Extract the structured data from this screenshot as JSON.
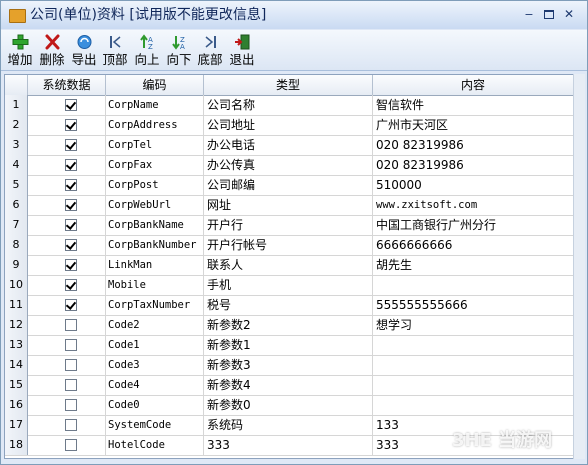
{
  "window": {
    "title": "公司(单位)资料 [试用版不能更改信息]"
  },
  "toolbar": {
    "buttons": [
      {
        "label": "增加",
        "icon": "add-icon"
      },
      {
        "label": "删除",
        "icon": "delete-icon"
      },
      {
        "label": "导出",
        "icon": "export-icon"
      },
      {
        "label": "顶部",
        "icon": "top-icon"
      },
      {
        "label": "向上",
        "icon": "up-icon"
      },
      {
        "label": "向下",
        "icon": "down-icon"
      },
      {
        "label": "底部",
        "icon": "bottom-icon"
      },
      {
        "label": "退出",
        "icon": "exit-icon"
      }
    ]
  },
  "table": {
    "columns": [
      "系统数据",
      "编码",
      "类型",
      "内容"
    ],
    "rows": [
      {
        "n": "1",
        "sys": true,
        "code": "CorpName",
        "type": "公司名称",
        "value": "智信软件"
      },
      {
        "n": "2",
        "sys": true,
        "code": "CorpAddress",
        "type": "公司地址",
        "value": "广州市天河区"
      },
      {
        "n": "3",
        "sys": true,
        "code": "CorpTel",
        "type": "办公电话",
        "value": "020 82319986"
      },
      {
        "n": "4",
        "sys": true,
        "code": "CorpFax",
        "type": "办公传真",
        "value": "020 82319986"
      },
      {
        "n": "5",
        "sys": true,
        "code": "CorpPost",
        "type": "公司邮编",
        "value": "510000"
      },
      {
        "n": "6",
        "sys": true,
        "code": "CorpWebUrl",
        "type": "网址",
        "value": "www.zxitsoft.com"
      },
      {
        "n": "7",
        "sys": true,
        "code": "CorpBankName",
        "type": "开户行",
        "value": "中国工商银行广州分行"
      },
      {
        "n": "8",
        "sys": true,
        "code": "CorpBankNumber",
        "type": "开户行帐号",
        "value": "6666666666"
      },
      {
        "n": "9",
        "sys": true,
        "code": "LinkMan",
        "type": "联系人",
        "value": "胡先生"
      },
      {
        "n": "10",
        "sys": true,
        "code": "Mobile",
        "type": "手机",
        "value": ""
      },
      {
        "n": "11",
        "sys": true,
        "code": "CorpTaxNumber",
        "type": "税号",
        "value": "555555555666"
      },
      {
        "n": "12",
        "sys": false,
        "code": "Code2",
        "type": "新参数2",
        "value": "想学习"
      },
      {
        "n": "13",
        "sys": false,
        "code": "Code1",
        "type": "新参数1",
        "value": ""
      },
      {
        "n": "14",
        "sys": false,
        "code": "Code3",
        "type": "新参数3",
        "value": ""
      },
      {
        "n": "15",
        "sys": false,
        "code": "Code4",
        "type": "新参数4",
        "value": ""
      },
      {
        "n": "16",
        "sys": false,
        "code": "Code0",
        "type": "新参数0",
        "value": ""
      },
      {
        "n": "17",
        "sys": false,
        "code": "SystemCode",
        "type": "系统码",
        "value": "133"
      },
      {
        "n": "18",
        "sys": false,
        "code": "HotelCode",
        "type": "333",
        "value": "333"
      }
    ]
  },
  "watermark": "3HE 当游网"
}
